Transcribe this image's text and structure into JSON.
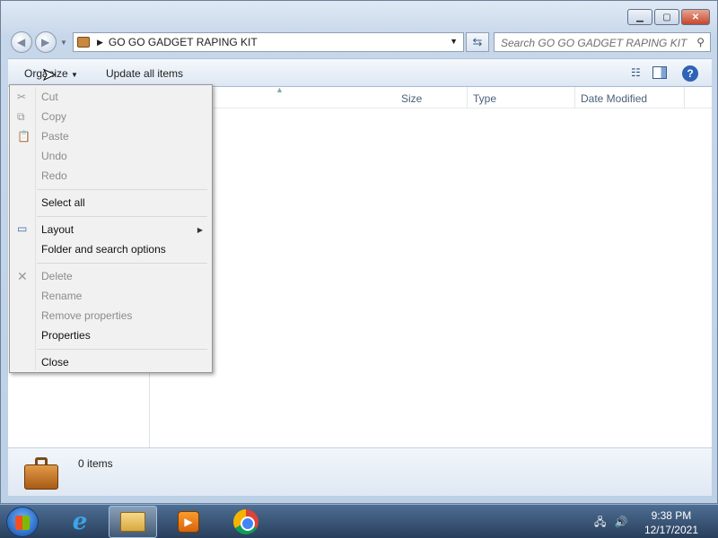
{
  "window": {
    "caption_buttons": [
      "minimize",
      "maximize",
      "close"
    ]
  },
  "address_bar": {
    "path": "GO GO GADGET RAPING KIT"
  },
  "search": {
    "placeholder": "Search GO GO GADGET RAPING KIT"
  },
  "command_bar": {
    "organize_label": "Organize",
    "update_label": "Update all items"
  },
  "columns": {
    "size": "Size",
    "type": "Type",
    "date_modified": "Date Modified"
  },
  "details_pane": {
    "item_count": "0 items"
  },
  "organize_menu": {
    "items": [
      {
        "label": "Cut",
        "enabled": false,
        "icon": "scissors-icon"
      },
      {
        "label": "Copy",
        "enabled": false,
        "icon": "copy-icon"
      },
      {
        "label": "Paste",
        "enabled": false,
        "icon": "paste-icon"
      },
      {
        "label": "Undo",
        "enabled": false
      },
      {
        "label": "Redo",
        "enabled": false
      },
      {
        "label": "Select all",
        "enabled": true
      },
      {
        "label": "Layout",
        "enabled": true,
        "icon": "layout-icon",
        "submenu": true
      },
      {
        "label": "Folder and search options",
        "enabled": true
      },
      {
        "label": "Delete",
        "enabled": false,
        "icon": "delete-icon"
      },
      {
        "label": "Rename",
        "enabled": false
      },
      {
        "label": "Remove properties",
        "enabled": false
      },
      {
        "label": "Properties",
        "enabled": true
      },
      {
        "label": "Close",
        "enabled": true
      }
    ]
  },
  "taskbar": {
    "apps": [
      "internet-explorer-icon",
      "windows-explorer-icon",
      "media-player-icon",
      "chrome-icon"
    ],
    "time": "9:38 PM",
    "date": "12/17/2021"
  },
  "colors": {
    "accent": "#2f63b6",
    "menu_disabled": "#8b8b8b",
    "taskbar": "#283f5c"
  }
}
